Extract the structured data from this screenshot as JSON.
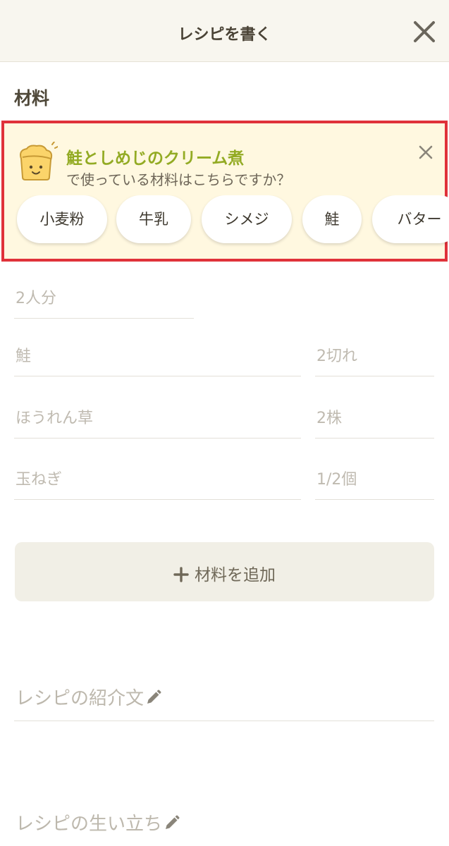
{
  "header": {
    "title": "レシピを書く",
    "close_icon": "close-icon"
  },
  "section": {
    "title": "材料"
  },
  "suggestion": {
    "title": "鮭としめじのクリーム煮",
    "subtitle": "で使っている材料はこちらですか？",
    "icon": "chef-toast-icon",
    "close_icon": "close-icon",
    "chips": [
      "小麦粉",
      "牛乳",
      "シメジ",
      "鮭",
      "バター"
    ],
    "colors": {
      "title": "#93ab24",
      "background": "#fff8e0",
      "highlight_border": "#e0323a"
    }
  },
  "ingredients": {
    "servings_placeholder": "2人分",
    "rows": [
      {
        "name_placeholder": "鮭",
        "qty_placeholder": "2切れ"
      },
      {
        "name_placeholder": "ほうれん草",
        "qty_placeholder": "2株"
      },
      {
        "name_placeholder": "玉ねぎ",
        "qty_placeholder": "1/2個"
      }
    ],
    "add_button_label": "材料を追加",
    "add_icon": "plus-icon"
  },
  "description": {
    "label": "レシピの紹介文",
    "icon": "pencil-icon"
  },
  "history": {
    "label": "レシピの生い立ち",
    "icon": "pencil-icon"
  }
}
